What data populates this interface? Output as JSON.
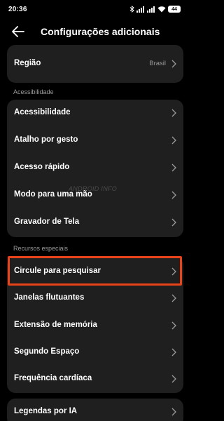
{
  "status": {
    "time": "20:36",
    "battery": "44"
  },
  "header": {
    "title": "Configurações adicionais"
  },
  "card_top": {
    "item": {
      "label": "Região",
      "value": "Brasil"
    }
  },
  "sections": {
    "accessibility": {
      "label": "Acessibilidade",
      "items": [
        "Acessibilidade",
        "Atalho por gesto",
        "Acesso rápido",
        "Modo para uma mão",
        "Gravador de Tela"
      ]
    },
    "special": {
      "label": "Recursos especiais",
      "items": [
        "Circule para pesquisar",
        "Janelas flutuantes",
        "Extensão de memória",
        "Segundo Espaço",
        "Frequência cardíaca"
      ]
    }
  },
  "card_bottom": {
    "item": {
      "label": "Legendas por IA"
    }
  },
  "watermark": "ANDROID INFO",
  "colors": {
    "background": "#000000",
    "card": "#1f1f1f",
    "highlight": "#e8431b",
    "secondary_text": "#9a9a9a"
  }
}
